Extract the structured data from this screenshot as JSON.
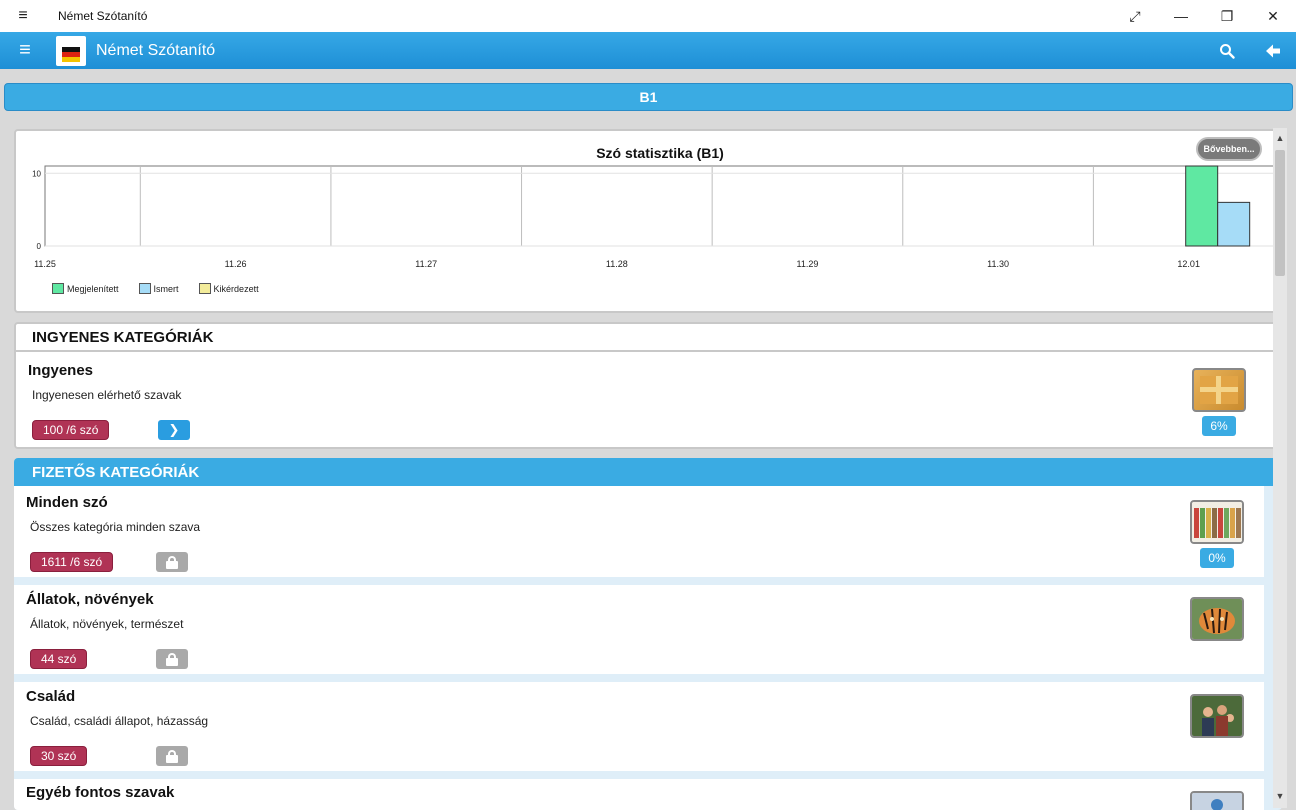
{
  "window": {
    "title": "Német Szótanító",
    "menu_icon": "≡",
    "controls": {
      "expand": "⤢",
      "minimize": "—",
      "restore": "❐",
      "close": "✕"
    }
  },
  "appbar": {
    "title": "Német Szótanító",
    "menu_icon": "≡",
    "search_icon": "⚲",
    "back_icon": "🡐"
  },
  "level": {
    "label": "B1"
  },
  "chart_data": {
    "type": "bar",
    "title": "Szó statisztika (B1)",
    "categories": [
      "11.25",
      "11.26",
      "11.27",
      "11.28",
      "11.29",
      "11.30",
      "12.01"
    ],
    "series": [
      {
        "name": "Megjelenített",
        "color": "#5fe8a2",
        "values": [
          0,
          0,
          0,
          0,
          0,
          0,
          11
        ]
      },
      {
        "name": "Ismert",
        "color": "#a6dcf7",
        "values": [
          0,
          0,
          0,
          0,
          0,
          0,
          6
        ]
      },
      {
        "name": "Kikérdezett",
        "color": "#f3ec9b",
        "values": [
          0,
          0,
          0,
          0,
          0,
          0,
          0
        ]
      }
    ],
    "yticks": [
      0,
      10
    ],
    "ylim": [
      0,
      11
    ],
    "legend": "bottom-left",
    "grid": true
  },
  "chart_more": {
    "label": "Bővebben..."
  },
  "free_section": {
    "header": "INGYENES KATEGÓRIÁK",
    "items": [
      {
        "title": "Ingyenes",
        "desc": "Ingyenesen elérhető szavak",
        "count": "100 /6 szó",
        "percent": "6%",
        "go_icon": "❯"
      }
    ]
  },
  "paid_section": {
    "header": "FIZETŐS KATEGÓRIÁK",
    "items": [
      {
        "title": "Minden szó",
        "desc": "Összes kategória minden szava",
        "count": "1611 /6 szó",
        "percent": "0%"
      },
      {
        "title": "Állatok, növények",
        "desc": "Állatok, növények, természet",
        "count": "44 szó"
      },
      {
        "title": "Család",
        "desc": "Család, családi állapot, házasság",
        "count": "30 szó"
      },
      {
        "title": "Egyéb fontos szavak"
      }
    ]
  },
  "colors": {
    "accent": "#3aabe3",
    "badge": "#b03355"
  }
}
